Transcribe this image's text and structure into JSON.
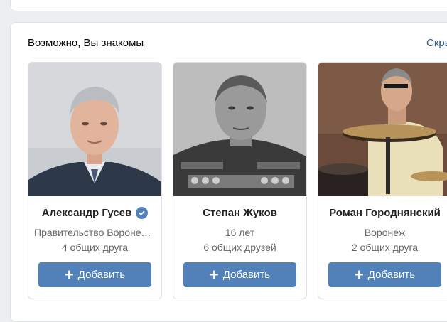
{
  "section": {
    "title": "Возможно, Вы знакомы",
    "link": "Скрыть"
  },
  "cards": [
    {
      "name": "Александр Гусев",
      "verified": true,
      "line1": "Правительство Воронежской области",
      "line2": "4 общих друга",
      "button": "Добавить",
      "button_icon": "plus-icon"
    },
    {
      "name": "Степан Жуков",
      "verified": false,
      "line1": "16 лет",
      "line2": "6 общих друзей",
      "button": "Добавить",
      "button_icon": "plus-icon"
    },
    {
      "name": "Роман Городнянский",
      "verified": false,
      "line1": "Воронеж",
      "line2": "2 общих друга",
      "button": "Добавить",
      "button_icon": "plus-icon"
    }
  ],
  "colors": {
    "accent": "#5181b8",
    "link": "#2a5885",
    "background": "#edeef0"
  }
}
